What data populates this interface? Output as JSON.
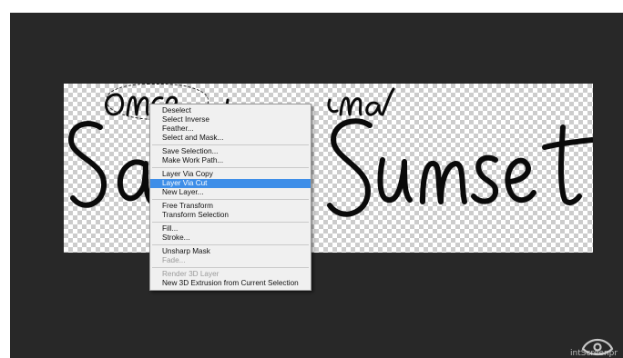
{
  "colors": {
    "workspace_bg": "#282828",
    "menu_bg": "#f0f0f0",
    "menu_highlight": "#3e8ee8",
    "menu_disabled_text": "#9a9a9a",
    "artwork_ink": "#0a0a0a"
  },
  "canvas": {
    "art_line1": "once upon a",
    "art_line2_left": "Sa",
    "art_line2_right": "Sunset"
  },
  "context_menu": {
    "groups": [
      [
        {
          "label": "Deselect",
          "state": "normal"
        },
        {
          "label": "Select Inverse",
          "state": "normal"
        },
        {
          "label": "Feather...",
          "state": "normal"
        },
        {
          "label": "Select and Mask...",
          "state": "normal"
        }
      ],
      [
        {
          "label": "Save Selection...",
          "state": "normal"
        },
        {
          "label": "Make Work Path...",
          "state": "normal"
        }
      ],
      [
        {
          "label": "Layer Via Copy",
          "state": "normal"
        },
        {
          "label": "Layer Via Cut",
          "state": "highlighted"
        },
        {
          "label": "New Layer...",
          "state": "normal"
        }
      ],
      [
        {
          "label": "Free Transform",
          "state": "normal"
        },
        {
          "label": "Transform Selection",
          "state": "normal"
        }
      ],
      [
        {
          "label": "Fill...",
          "state": "normal"
        },
        {
          "label": "Stroke...",
          "state": "normal"
        }
      ],
      [
        {
          "label": "Unsharp Mask",
          "state": "normal"
        },
        {
          "label": "Fade...",
          "state": "disabled"
        }
      ],
      [
        {
          "label": "Render 3D Layer",
          "state": "disabled"
        },
        {
          "label": "New 3D Extrusion from Current Selection",
          "state": "normal"
        }
      ]
    ]
  },
  "watermark": {
    "icon": "eye-logo-icon",
    "text": "intScreenpr"
  }
}
